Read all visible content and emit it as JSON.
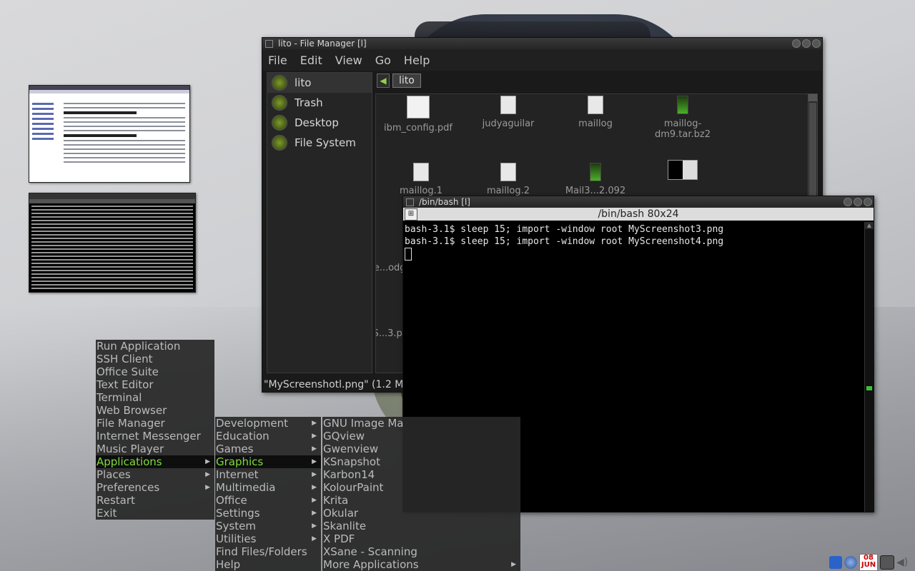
{
  "file_manager": {
    "title": "lito - File Manager [l]",
    "menu": [
      "File",
      "Edit",
      "View",
      "Go",
      "Help"
    ],
    "places": [
      "lito",
      "Trash",
      "Desktop",
      "File System"
    ],
    "path_button": "lito",
    "files": [
      "ibm_config.pdf",
      "judyaguilar",
      "maillog",
      "maillog-dm9.tar.bz2",
      "maillog.1",
      "maillog.2",
      "Mail3...2.092",
      "me...odg...",
      "MyS...3.pn..."
    ],
    "status": "\"MyScreenshotl.png\" (1.2 M"
  },
  "terminal": {
    "title": "/bin/bash [l]",
    "tab_label": "/bin/bash 80x24",
    "lines": [
      "bash-3.1$ sleep 15; import -window root MyScreenshot3.png",
      "bash-3.1$ sleep 15; import -window root MyScreenshot4.png"
    ]
  },
  "main_menu": {
    "items": [
      {
        "label": "Run Application",
        "submenu": false
      },
      {
        "label": "SSH Client",
        "submenu": false
      },
      {
        "label": "Office Suite",
        "submenu": false
      },
      {
        "label": "Text Editor",
        "submenu": false
      },
      {
        "label": "Terminal",
        "submenu": false
      },
      {
        "label": "Web Browser",
        "submenu": false
      },
      {
        "label": "File Manager",
        "submenu": false
      },
      {
        "label": "Internet Messenger",
        "submenu": false
      },
      {
        "label": "Music Player",
        "submenu": false
      },
      {
        "label": "Applications",
        "submenu": true,
        "active": true
      },
      {
        "label": "Places",
        "submenu": true
      },
      {
        "label": "Preferences",
        "submenu": true
      },
      {
        "label": "Restart",
        "submenu": false
      },
      {
        "label": "Exit",
        "submenu": false
      }
    ]
  },
  "applications_menu": {
    "items": [
      {
        "label": "Development",
        "submenu": true
      },
      {
        "label": "Education",
        "submenu": true
      },
      {
        "label": "Games",
        "submenu": true
      },
      {
        "label": "Graphics",
        "submenu": true,
        "active": true
      },
      {
        "label": "Internet",
        "submenu": true
      },
      {
        "label": "Multimedia",
        "submenu": true
      },
      {
        "label": "Office",
        "submenu": true
      },
      {
        "label": "Settings",
        "submenu": true
      },
      {
        "label": "System",
        "submenu": true
      },
      {
        "label": "Utilities",
        "submenu": true
      },
      {
        "label": "Find Files/Folders",
        "submenu": false
      },
      {
        "label": "Help",
        "submenu": false
      }
    ]
  },
  "graphics_menu": {
    "items": [
      {
        "label": "GNU Image Ma",
        "submenu": false
      },
      {
        "label": "GQview",
        "submenu": false
      },
      {
        "label": "Gwenview",
        "submenu": false
      },
      {
        "label": "KSnapshot",
        "submenu": false
      },
      {
        "label": "Karbon14",
        "submenu": false
      },
      {
        "label": "KolourPaint",
        "submenu": false
      },
      {
        "label": "Krita",
        "submenu": false
      },
      {
        "label": "Okular",
        "submenu": false
      },
      {
        "label": "Skanlite",
        "submenu": false
      },
      {
        "label": "X PDF",
        "submenu": false
      },
      {
        "label": "XSane - Scanning",
        "submenu": false
      },
      {
        "label": "More Applications",
        "submenu": true
      }
    ]
  },
  "tray": {
    "clock_top": "08",
    "clock_bottom": "JUN",
    "icons": [
      "back-arrow-icon",
      "network-icon",
      "calendar-icon",
      "monitor-icon",
      "volume-icon"
    ]
  },
  "colors": {
    "menu_active_text": "#7ddc3a",
    "menu_text": "#bbbbbb",
    "terminal_bg": "#000000",
    "fm_bg": "#1a1a1a"
  }
}
